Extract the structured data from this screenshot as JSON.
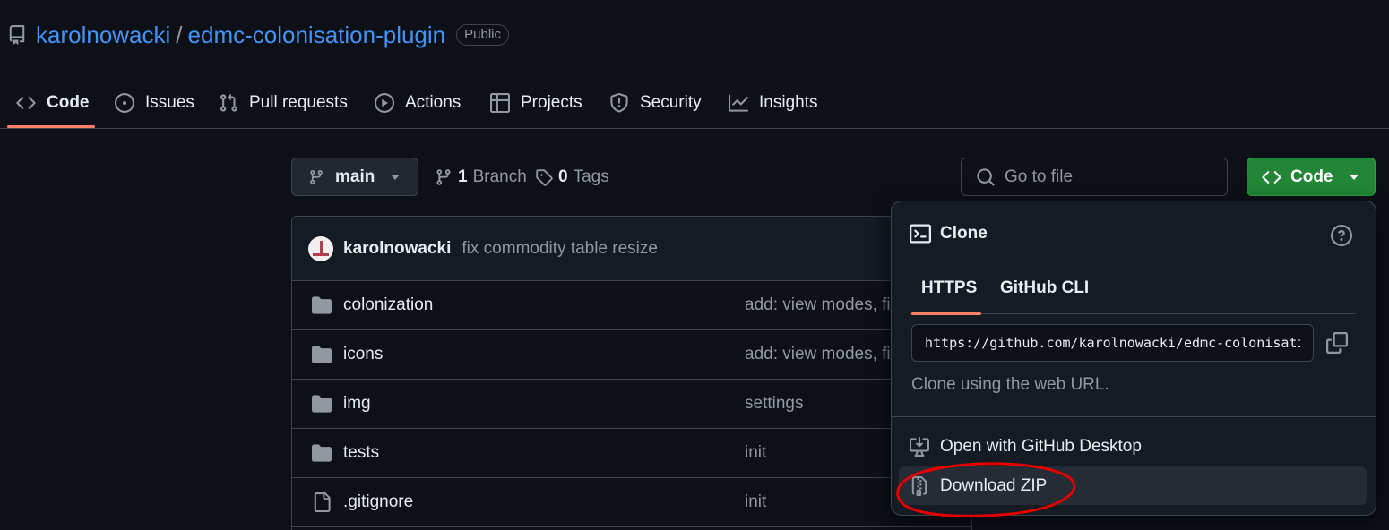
{
  "repo": {
    "owner": "karolnowacki",
    "separator": "/",
    "name": "edmc-colonisation-plugin",
    "visibility": "Public",
    "icon": "repo-icon"
  },
  "tabs": [
    {
      "label": "Code",
      "icon": "code-icon",
      "active": true
    },
    {
      "label": "Issues",
      "icon": "issue-opened-icon"
    },
    {
      "label": "Pull requests",
      "icon": "git-pull-request-icon"
    },
    {
      "label": "Actions",
      "icon": "play-icon"
    },
    {
      "label": "Projects",
      "icon": "table-icon"
    },
    {
      "label": "Security",
      "icon": "shield-icon"
    },
    {
      "label": "Insights",
      "icon": "graph-icon"
    }
  ],
  "toolbar": {
    "branch": "main",
    "branch_count": "1",
    "branch_label": "Branch",
    "tag_count": "0",
    "tag_label": "Tags",
    "search_placeholder": "Go to file",
    "code_button": "Code"
  },
  "commit": {
    "author": "karolnowacki",
    "message": "fix commodity table resize"
  },
  "files": [
    {
      "name": "colonization",
      "type": "folder",
      "message": "add: view modes, fix"
    },
    {
      "name": "icons",
      "type": "folder",
      "message": "add: view modes, fix"
    },
    {
      "name": "img",
      "type": "folder",
      "message": "settings"
    },
    {
      "name": "tests",
      "type": "folder",
      "message": "init"
    },
    {
      "name": ".gitignore",
      "type": "file",
      "message": "init"
    }
  ],
  "clone_menu": {
    "title": "Clone",
    "tabs": [
      "HTTPS",
      "GitHub CLI"
    ],
    "active_tab": "HTTPS",
    "url": "https://github.com/karolnowacki/edmc-colonisation-plugin.git",
    "hint": "Clone using the web URL.",
    "open_desktop": "Open with GitHub Desktop",
    "download_zip": "Download ZIP"
  },
  "colors": {
    "background": "#0d1117",
    "accent_link": "#4493f8",
    "primary_button": "#238636",
    "tab_underline": "#f78166",
    "annotation": "#e00000"
  }
}
